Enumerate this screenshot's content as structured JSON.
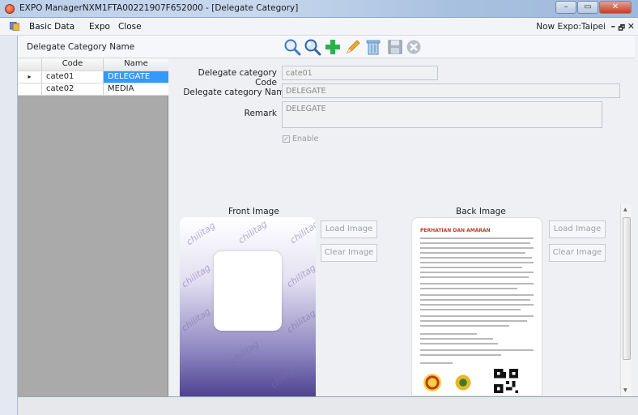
{
  "window": {
    "title": "EXPO ManagerNXM1FTA00221907F652000 - [Delegate Category]",
    "buttons": {
      "minimize": "–",
      "maximize": "▭",
      "close": "✕"
    }
  },
  "menu": {
    "items": [
      "Basic Data",
      "Expo",
      "Close"
    ],
    "now_expo": "Now Expo:Taipei",
    "mdi_minimize": "–",
    "mdi_restore": "🗗",
    "mdi_close": "✕"
  },
  "toolbar": {
    "form_title": "Delegate Category Name",
    "tools": [
      "search-icon",
      "zoom-icon",
      "add-icon",
      "edit-icon",
      "delete-icon",
      "save-icon",
      "cancel-icon"
    ]
  },
  "grid": {
    "headers": [
      "Code",
      "Name"
    ],
    "current_marker": "▸",
    "rows": [
      {
        "code": "cate01",
        "name": "DELEGATE",
        "selected": true
      },
      {
        "code": "cate02",
        "name": "MEDIA",
        "selected": false
      }
    ]
  },
  "form": {
    "code_label": "Delegate category Code",
    "code_value": "cate01",
    "name_label": "Delegate category  Name",
    "name_value": "DELEGATE",
    "remark_label": "Remark",
    "remark_value": "DELEGATE",
    "enable_label": "Enable",
    "enable_checked": true,
    "check_mark": "✓"
  },
  "images": {
    "front_label": "Front Image",
    "back_label": "Back Image",
    "load_label": "Load Image",
    "clear_label": "Clear Image",
    "watermark": "chilitag",
    "back_heading": "PERHATIAN DAN AMARAN"
  },
  "colors": {
    "selection": "#3399ff",
    "card_purple": "#4f4392",
    "add_green": "#2bb24c",
    "accent_red": "#c0392b"
  }
}
